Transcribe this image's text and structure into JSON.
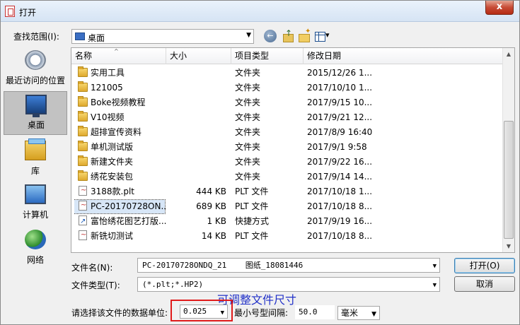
{
  "window": {
    "title": "打开",
    "close_glyph": "x"
  },
  "lookin": {
    "label": "查找范围(I):",
    "value": "桌面"
  },
  "places": [
    {
      "label": "最近访问的位置"
    },
    {
      "label": "桌面"
    },
    {
      "label": "库"
    },
    {
      "label": "计算机"
    },
    {
      "label": "网络"
    }
  ],
  "columns": {
    "name": "名称",
    "size": "大小",
    "type": "项目类型",
    "date": "修改日期"
  },
  "files": [
    {
      "name": "实用工具",
      "size": "",
      "type": "文件夹",
      "date": "2015/12/26 1...",
      "icon": "folder"
    },
    {
      "name": "121005",
      "size": "",
      "type": "文件夹",
      "date": "2017/10/10 1...",
      "icon": "folder"
    },
    {
      "name": "Boke视频教程",
      "size": "",
      "type": "文件夹",
      "date": "2017/9/15 10...",
      "icon": "folder"
    },
    {
      "name": "V10视频",
      "size": "",
      "type": "文件夹",
      "date": "2017/9/21 12...",
      "icon": "folder"
    },
    {
      "name": "超排宣传资料",
      "size": "",
      "type": "文件夹",
      "date": "2017/8/9 16:40",
      "icon": "folder"
    },
    {
      "name": "单机测试版",
      "size": "",
      "type": "文件夹",
      "date": "2017/9/1 9:58",
      "icon": "folder"
    },
    {
      "name": "新建文件夹",
      "size": "",
      "type": "文件夹",
      "date": "2017/9/22 16...",
      "icon": "folder"
    },
    {
      "name": "绣花安装包",
      "size": "",
      "type": "文件夹",
      "date": "2017/9/14 14...",
      "icon": "folder"
    },
    {
      "name": "3188款.plt",
      "size": "444 KB",
      "type": "PLT 文件",
      "date": "2017/10/18 1...",
      "icon": "plt"
    },
    {
      "name": "PC-20170728ON...",
      "size": "689 KB",
      "type": "PLT 文件",
      "date": "2017/10/18 8...",
      "icon": "plt",
      "selected": true
    },
    {
      "name": "富怡绣花图艺打版...",
      "size": "1 KB",
      "type": "快捷方式",
      "date": "2017/9/19 16...",
      "icon": "lnk"
    },
    {
      "name": "新铣切测试",
      "size": "14 KB",
      "type": "PLT 文件",
      "date": "2017/10/18 8...",
      "icon": "plt"
    }
  ],
  "filename": {
    "label": "文件名(N):",
    "value": "PC-20170728ONDQ_21    图纸_18081446"
  },
  "filetype": {
    "label": "文件类型(T):",
    "value": "(*.plt;*.HP2)"
  },
  "buttons": {
    "open": "打开(O)",
    "cancel": "取消"
  },
  "units": {
    "label": "请选择该文件的数据单位:",
    "value": "0.025"
  },
  "min_spacing": {
    "label": "最小号型间隔:",
    "value": "50.0",
    "unit": "毫米"
  },
  "annotation": "可调整文件尺寸",
  "colors": {
    "selection": "#d7e6f7",
    "highlight_box": "#e01b1b",
    "annotation": "#2030c8"
  }
}
